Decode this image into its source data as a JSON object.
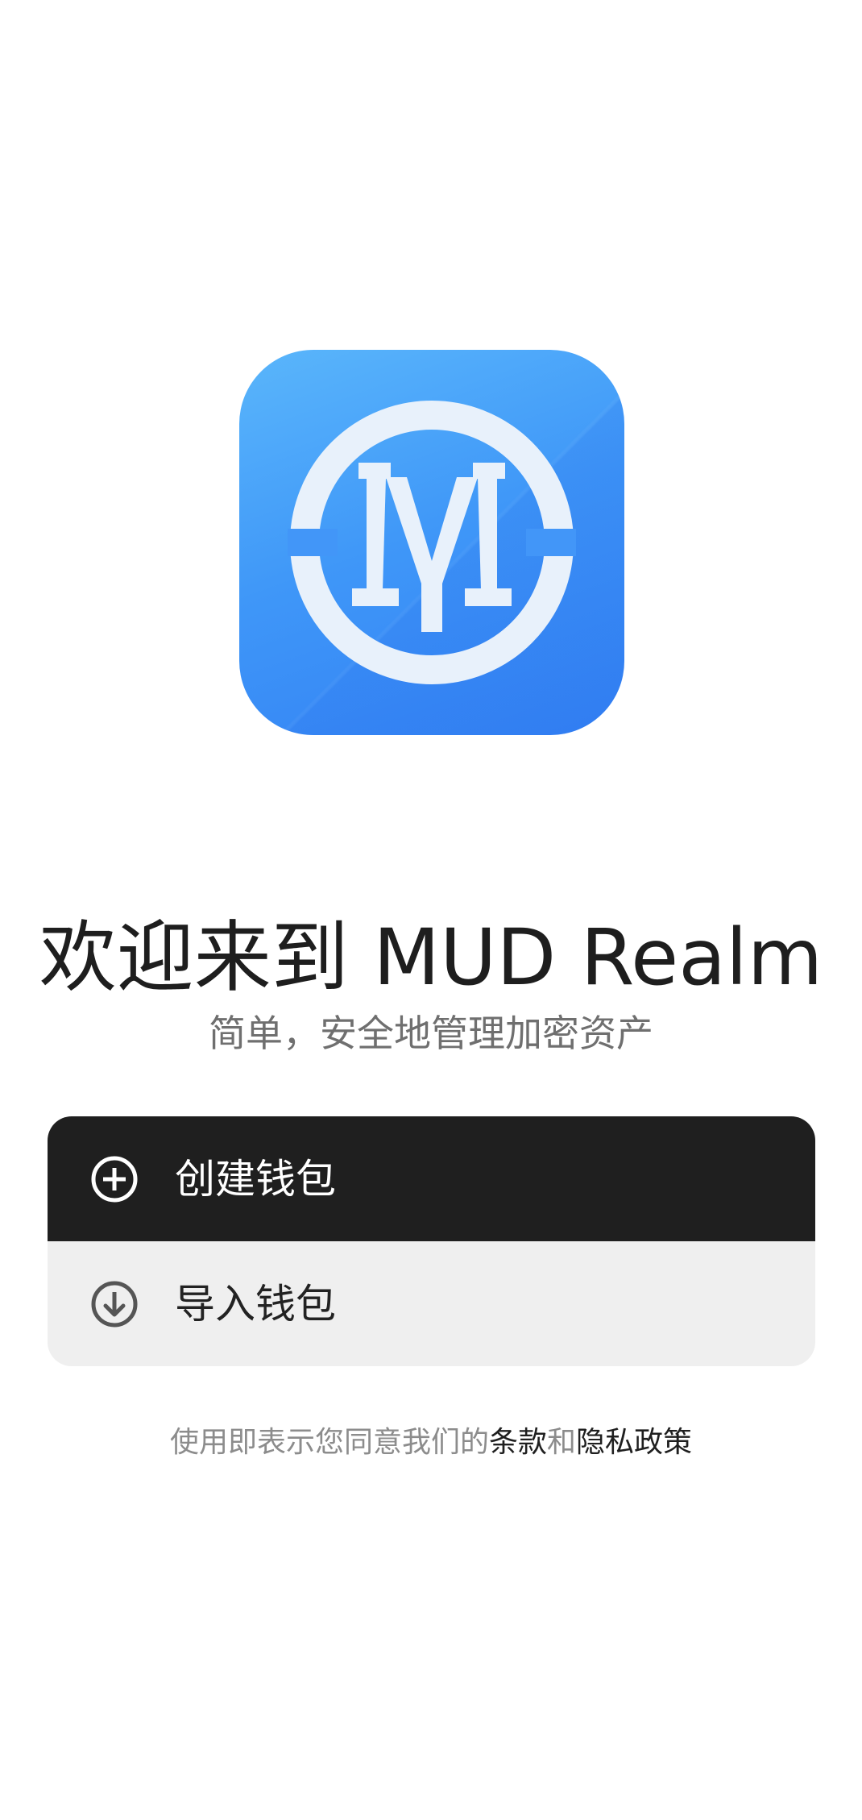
{
  "logo": {
    "icon": "mud-realm-logo-icon",
    "bg_top": "#5ab6fb",
    "bg_bottom": "#3280f4",
    "mark_color": "#e8f1fb"
  },
  "welcome": {
    "title": "欢迎来到 MUD Realm",
    "subtitle": "简单，安全地管理加密资产"
  },
  "actions": {
    "create": {
      "label": "创建钱包",
      "icon": "plus-circle-icon",
      "bg": "#1f1f1f"
    },
    "import": {
      "label": "导入钱包",
      "icon": "download-circle-icon",
      "bg": "#efefef"
    }
  },
  "terms": {
    "prefix": "使用即表示您同意我们的",
    "terms_link": "条款",
    "conjunction": "和",
    "privacy_link": "隐私政策"
  }
}
